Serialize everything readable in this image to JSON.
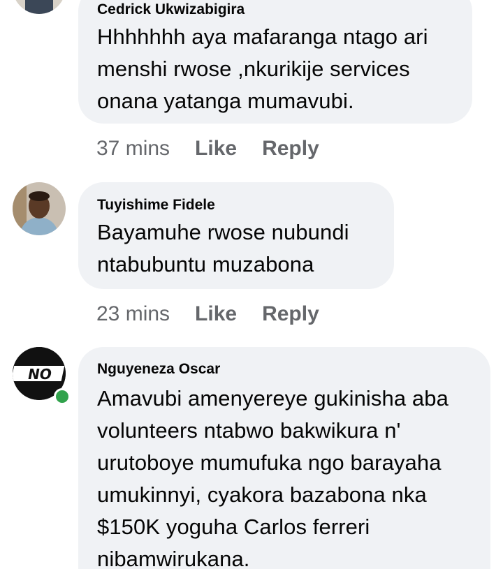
{
  "comments": [
    {
      "author": "Cedrick Ukwizabigira",
      "text": "Hhhhhhh aya mafaranga ntago ari menshi rwose ,nkurikije services onana yatanga mumavubi.",
      "time": "37 mins",
      "like_label": "Like",
      "reply_label": "Reply",
      "avatar_icon": "user-avatar-icon"
    },
    {
      "author": "Tuyishime Fidele",
      "text": "Bayamuhe rwose nubundi ntabubuntu muzabona",
      "time": "23 mins",
      "like_label": "Like",
      "reply_label": "Reply",
      "avatar_icon": "user-avatar-icon"
    },
    {
      "author": "Nguyeneza Oscar",
      "text": "Amavubi amenyereye gukinisha aba volunteers ntabwo bakwikura n' urutoboye mumufuka ngo barayaha umukinnyi, cyakora bazabona nka $150K yoguha Carlos ferreri nibamwirukana.",
      "time": "",
      "like_label": "",
      "reply_label": "",
      "avatar_icon": "no-logo-avatar-icon",
      "avatar_logo_text": "NO",
      "online": true
    }
  ],
  "colors": {
    "bubble_bg": "#f0f2f5",
    "text": "#050505",
    "meta_text": "#65676b",
    "online_green": "#31a24c"
  }
}
